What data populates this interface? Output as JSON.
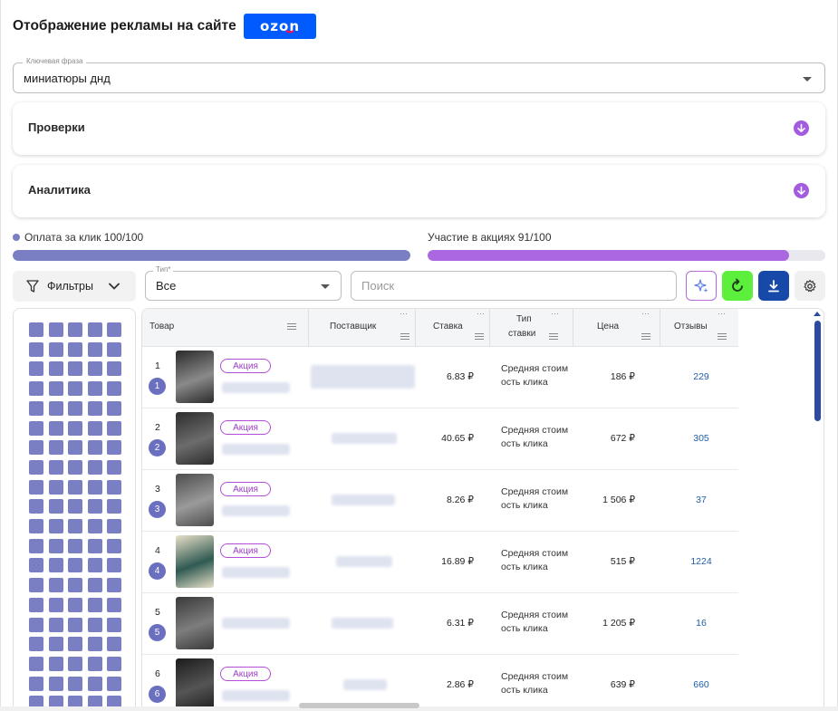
{
  "header": {
    "title": "Отображение рекламы на сайте",
    "logo_text": "ozon"
  },
  "keyword": {
    "label": "Ключевая фраза",
    "value": "миниатюры днд"
  },
  "accordions": {
    "checks": "Проверки",
    "analytics": "Аналитика"
  },
  "progress": {
    "cpc_label": "Оплата за клик 100/100",
    "cpc_fraction": 1.0,
    "promo_label": "Участие в акциях 91/100",
    "promo_fraction": 0.91,
    "cpc_color": "#7a7fc4",
    "promo_color": "#ab67e0"
  },
  "toolbar": {
    "filters_label": "Фильтры",
    "type_label": "Тип*",
    "type_value": "Все",
    "search_placeholder": "Поиск",
    "icons": [
      "sparkle-icon",
      "refresh-icon",
      "download-icon",
      "settings-icon"
    ]
  },
  "table": {
    "columns": {
      "product": "Товар",
      "supplier": "Поставщик",
      "bid": "Ставка",
      "bid_type_1": "Тип",
      "bid_type_2": "ставки",
      "price": "Цена",
      "reviews": "Отзывы"
    },
    "rows": [
      {
        "num": "1",
        "pos": "1",
        "badge": "Акция",
        "bid": "6.83 ₽",
        "type_1": "Средняя стоим",
        "type_2": "ость клика",
        "price": "186 ₽",
        "reviews": "229"
      },
      {
        "num": "2",
        "pos": "2",
        "badge": "Акция",
        "bid": "40.65 ₽",
        "type_1": "Средняя стоим",
        "type_2": "ость клика",
        "price": "672 ₽",
        "reviews": "305"
      },
      {
        "num": "3",
        "pos": "3",
        "badge": "Акция",
        "bid": "8.26 ₽",
        "type_1": "Средняя стоим",
        "type_2": "ость клика",
        "price": "1 506 ₽",
        "reviews": "37"
      },
      {
        "num": "4",
        "pos": "4",
        "badge": "Акция",
        "bid": "16.89 ₽",
        "type_1": "Средняя стоим",
        "type_2": "ость клика",
        "price": "515 ₽",
        "reviews": "1224"
      },
      {
        "num": "5",
        "pos": "5",
        "badge": "",
        "bid": "6.31 ₽",
        "type_1": "Средняя стоим",
        "type_2": "ость клика",
        "price": "1 205 ₽",
        "reviews": "16"
      },
      {
        "num": "6",
        "pos": "6",
        "badge": "Акция",
        "bid": "2.86 ₽",
        "type_1": "Средняя стоим",
        "type_2": "ость клика",
        "price": "639 ₽",
        "reviews": "660"
      }
    ]
  }
}
